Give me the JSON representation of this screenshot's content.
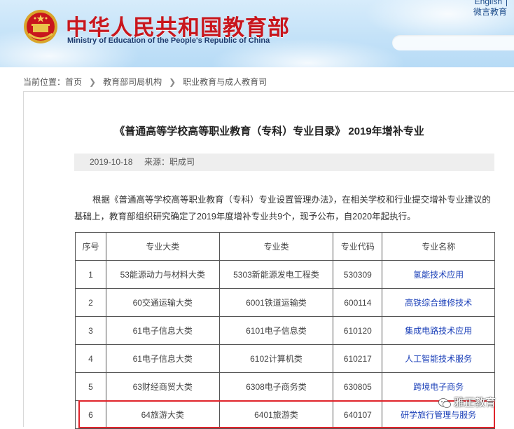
{
  "header": {
    "site_title": "中华人民共和国教育部",
    "site_subtitle": "Ministry of Education of the People's Republic of China",
    "links": {
      "english": "English",
      "weibo": "微言教育"
    }
  },
  "breadcrumb": {
    "prefix": "当前位置：",
    "items": [
      "首页",
      "教育部司局机构",
      "职业教育与成人教育司"
    ]
  },
  "article": {
    "title": "《普通高等学校高等职业教育（专科）专业目录》 2019年增补专业",
    "date": "2019-10-18",
    "source": "来源：职成司",
    "paragraph": "根据《普通高等学校高等职业教育（专科）专业设置管理办法》，在相关学校和行业提交增补专业建议的基础上，教育部组织研究确定了2019年度增补专业共9个，现予公布，自2020年起执行。"
  },
  "table": {
    "headers": [
      "序号",
      "专业大类",
      "专业类",
      "专业代码",
      "专业名称"
    ],
    "rows": [
      {
        "no": "1",
        "category": "53能源动力与材料大类",
        "class": "5303新能源发电工程类",
        "code": "530309",
        "name": "氢能技术应用"
      },
      {
        "no": "2",
        "category": "60交通运输大类",
        "class": "6001铁道运输类",
        "code": "600114",
        "name": "高铁综合维修技术"
      },
      {
        "no": "3",
        "category": "61电子信息大类",
        "class": "6101电子信息类",
        "code": "610120",
        "name": "集成电路技术应用"
      },
      {
        "no": "4",
        "category": "61电子信息大类",
        "class": "6102计算机类",
        "code": "610217",
        "name": "人工智能技术服务"
      },
      {
        "no": "5",
        "category": "63财经商贸大类",
        "class": "6308电子商务类",
        "code": "630805",
        "name": "跨境电子商务"
      },
      {
        "no": "6",
        "category": "64旅游大类",
        "class": "6401旅游类",
        "code": "640107",
        "name": "研学旅行管理与服务"
      }
    ]
  },
  "watermark": "雅正教育",
  "colors": {
    "title_red": "#c8161d",
    "link_blue": "#1a3fb8",
    "highlight_red": "#e0242b"
  }
}
